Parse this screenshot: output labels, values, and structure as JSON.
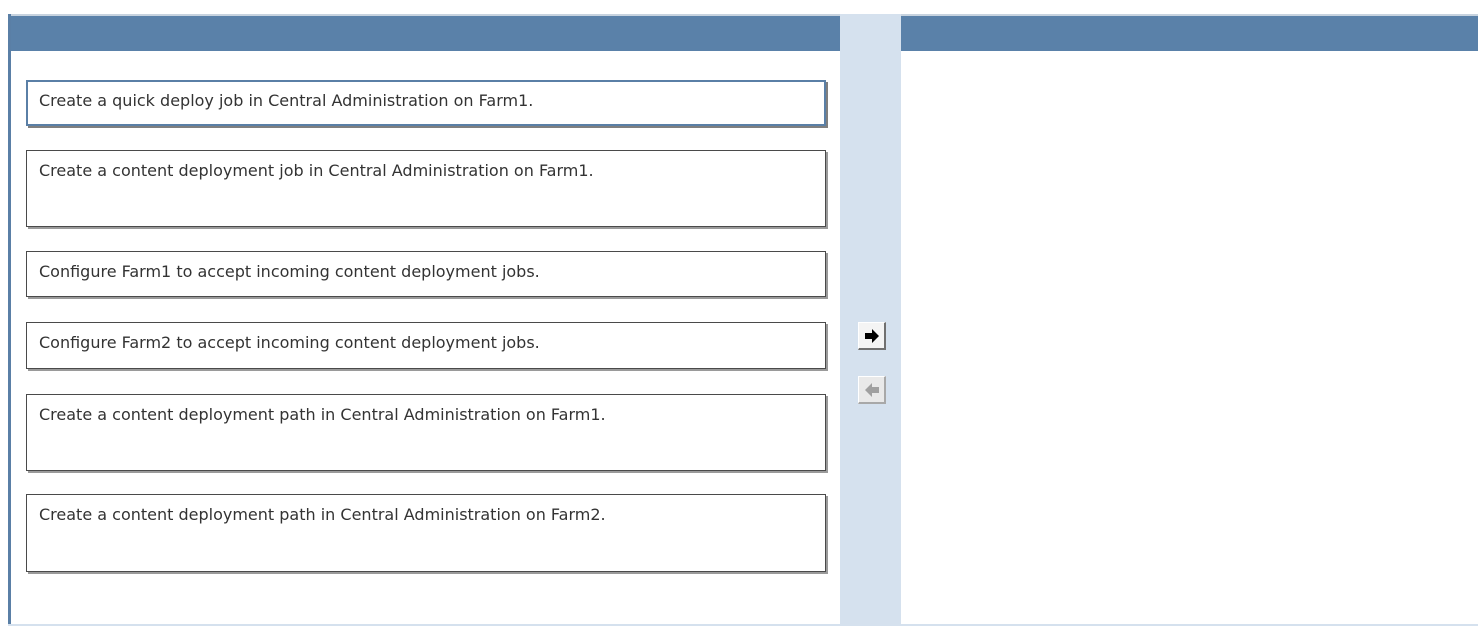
{
  "source_list": {
    "items": [
      {
        "label": "Create a quick deploy job in Central Administration on Farm1.",
        "selected": true
      },
      {
        "label": "Create a content deployment job in Central Administration on Farm1.",
        "selected": false
      },
      {
        "label": "Configure Farm1 to accept incoming content deployment jobs.",
        "selected": false
      },
      {
        "label": "Configure Farm2 to accept incoming content deployment jobs.",
        "selected": false
      },
      {
        "label": "Create a content deployment path in Central Administration on Farm1.",
        "selected": false
      },
      {
        "label": "Create a content deployment path in Central Administration on Farm2.",
        "selected": false
      }
    ]
  },
  "controls": {
    "move_right_icon": "arrow-right-icon",
    "move_left_icon": "arrow-left-icon"
  },
  "target_list": {
    "items": []
  },
  "colors": {
    "header": "#5a81a9",
    "middle_bar": "#d5e1ee",
    "selected_border": "#5a7fa6"
  }
}
